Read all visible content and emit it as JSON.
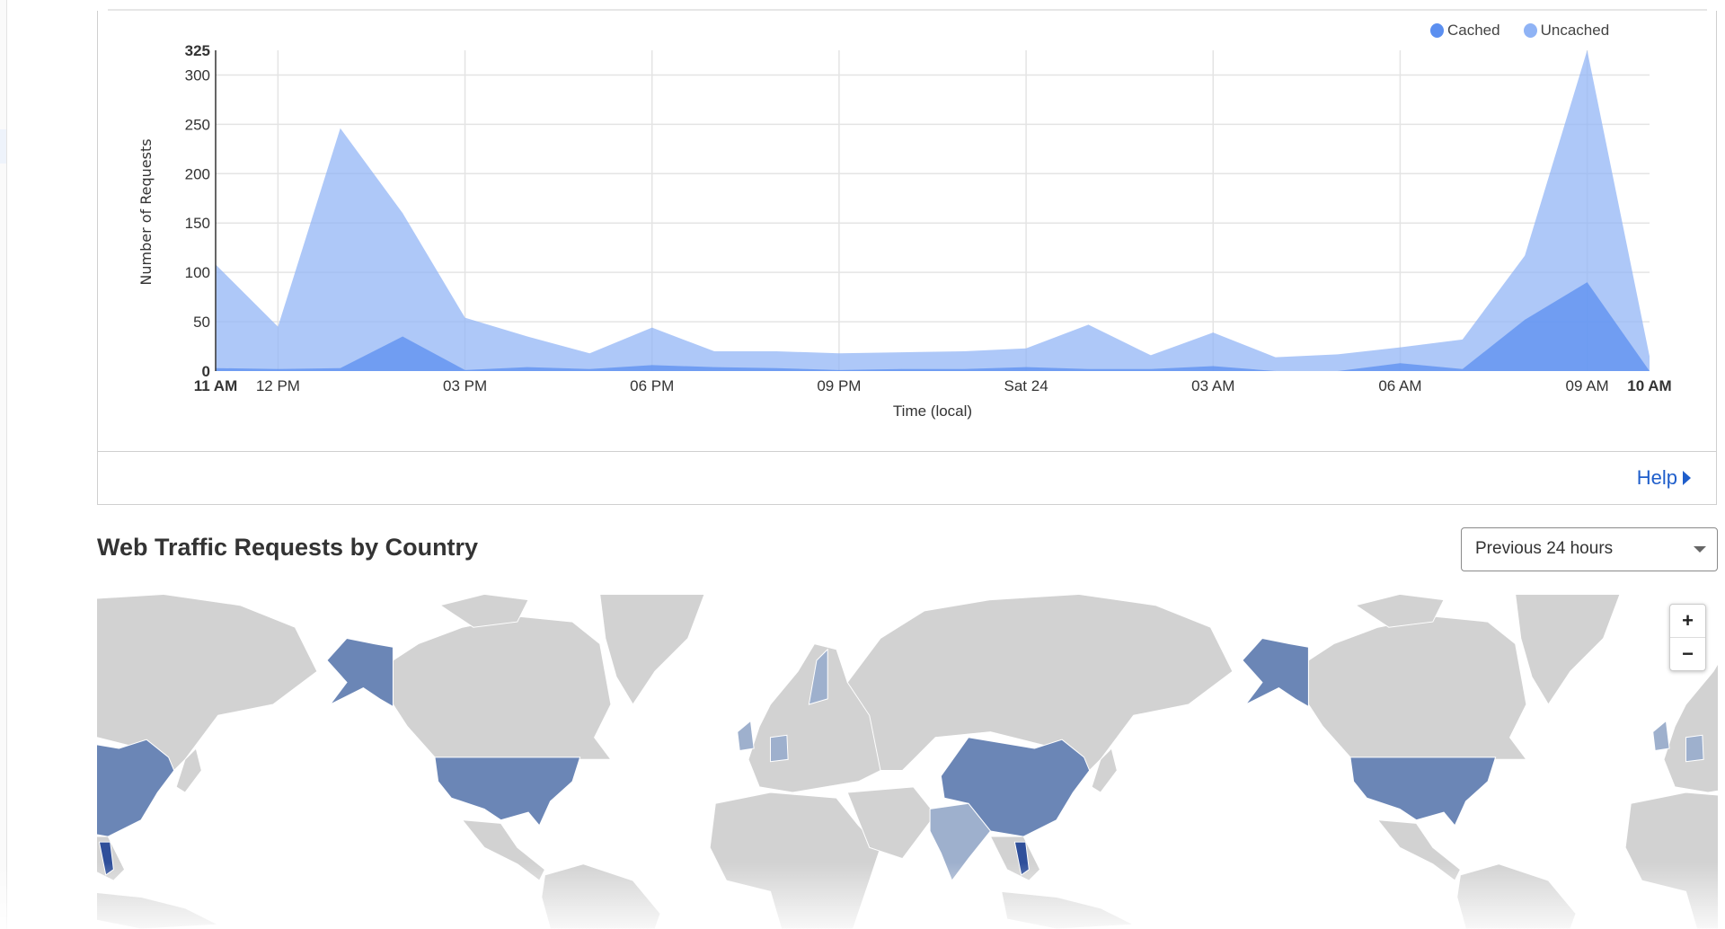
{
  "traffic_chart": {
    "legend": [
      {
        "label": "Cached",
        "color": "#5b8ff0"
      },
      {
        "label": "Uncached",
        "color": "#8fb3f5"
      }
    ],
    "help_label": "Help"
  },
  "chart_data": {
    "type": "area",
    "xlabel": "Time (local)",
    "ylabel": "Number of Requests",
    "ylim": [
      0,
      325
    ],
    "yticks": [
      "0",
      "50",
      "100",
      "150",
      "200",
      "250",
      "300",
      "325"
    ],
    "xticks": [
      {
        "hour": 0,
        "label": "11 AM",
        "bold": true
      },
      {
        "hour": 1,
        "label": "12 PM"
      },
      {
        "hour": 4,
        "label": "03 PM"
      },
      {
        "hour": 7,
        "label": "06 PM"
      },
      {
        "hour": 10,
        "label": "09 PM"
      },
      {
        "hour": 13,
        "label": "Sat 24"
      },
      {
        "hour": 16,
        "label": "03 AM"
      },
      {
        "hour": 19,
        "label": "06 AM"
      },
      {
        "hour": 22,
        "label": "09 AM"
      },
      {
        "hour": 23,
        "label": "10 AM",
        "bold": true
      }
    ],
    "x": [
      "11 AM",
      "12 PM",
      "01 PM",
      "02 PM",
      "03 PM",
      "04 PM",
      "05 PM",
      "06 PM",
      "07 PM",
      "08 PM",
      "09 PM",
      "10 PM",
      "11 PM",
      "12 AM",
      "01 AM",
      "02 AM",
      "03 AM",
      "04 AM",
      "05 AM",
      "06 AM",
      "07 AM",
      "08 AM",
      "09 AM",
      "10 AM"
    ],
    "grid": true,
    "legend_position": "top-right",
    "series": [
      {
        "name": "Uncached",
        "color": "#8fb3f5",
        "values": [
          108,
          45,
          246,
          160,
          54,
          35,
          18,
          44,
          20,
          20,
          18,
          19,
          20,
          23,
          47,
          16,
          39,
          14,
          17,
          24,
          32,
          117,
          325,
          15
        ]
      },
      {
        "name": "Cached",
        "color": "#5b8ff0",
        "values": [
          3,
          2,
          3,
          35,
          1,
          4,
          2,
          6,
          4,
          3,
          1,
          2,
          2,
          4,
          2,
          2,
          5,
          0,
          0,
          8,
          2,
          52,
          90,
          0
        ]
      }
    ]
  },
  "country_section": {
    "title": "Web Traffic Requests by Country",
    "range_select": "Previous 24 hours",
    "zoom_in": "+",
    "zoom_out": "−",
    "colors": {
      "land": "#d2d2d2",
      "high": "#6b86b6",
      "medium": "#9eb0cd",
      "dark": "#2f4f9a"
    }
  }
}
